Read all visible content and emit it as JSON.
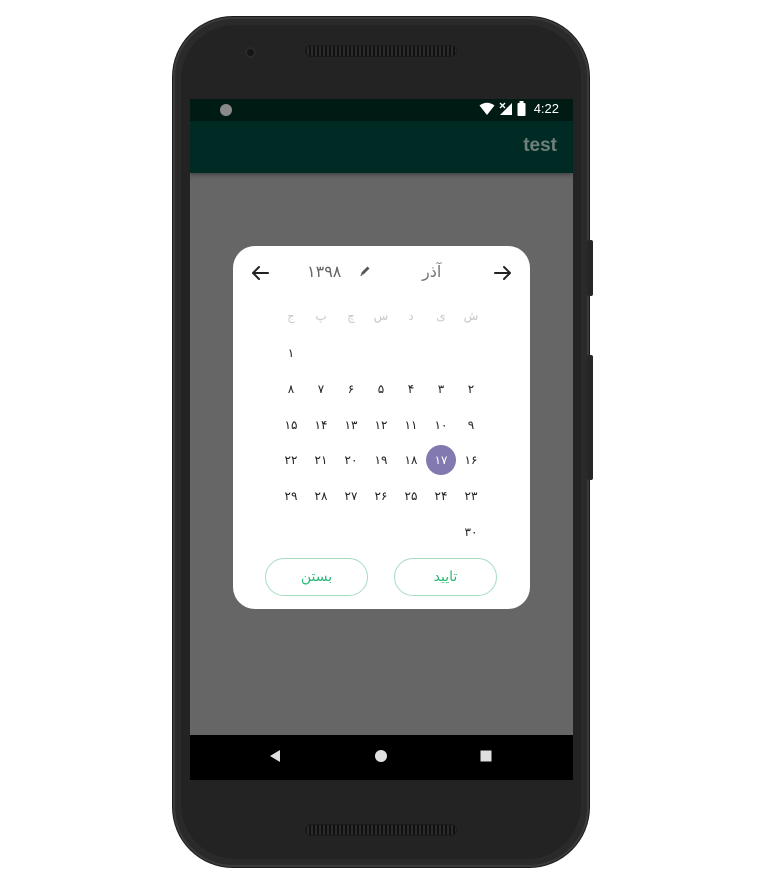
{
  "app": {
    "title": "test"
  },
  "status_bar": {
    "time": "4:22"
  },
  "calendar": {
    "month": "آذر",
    "year": "۱۳۹۸",
    "weekdays": [
      "ش",
      "ی",
      "د",
      "س",
      "چ",
      "پ",
      "ج"
    ],
    "selected_day": "۱۷",
    "weeks": [
      [
        "",
        "",
        "",
        "",
        "",
        "",
        "۱"
      ],
      [
        "۲",
        "۳",
        "۴",
        "۵",
        "۶",
        "۷",
        "۸"
      ],
      [
        "۹",
        "۱۰",
        "۱۱",
        "۱۲",
        "۱۳",
        "۱۴",
        "۱۵"
      ],
      [
        "۱۶",
        "۱۷",
        "۱۸",
        "۱۹",
        "۲۰",
        "۲۱",
        "۲۲"
      ],
      [
        "۲۳",
        "۲۴",
        "۲۵",
        "۲۶",
        "۲۷",
        "۲۸",
        "۲۹"
      ],
      [
        "۳۰",
        "",
        "",
        "",
        "",
        "",
        ""
      ]
    ]
  },
  "buttons": {
    "confirm": "تایید",
    "close": "بستن"
  },
  "colors": {
    "accent": "#2eb87a",
    "selected": "#8279b0",
    "app_bar": "#002b24"
  },
  "icons": {
    "prev": "arrow-left-icon",
    "next": "arrow-right-icon",
    "edit": "pencil-icon",
    "nav_back": "back-triangle-icon",
    "nav_home": "home-circle-icon",
    "nav_recent": "recent-square-icon"
  }
}
